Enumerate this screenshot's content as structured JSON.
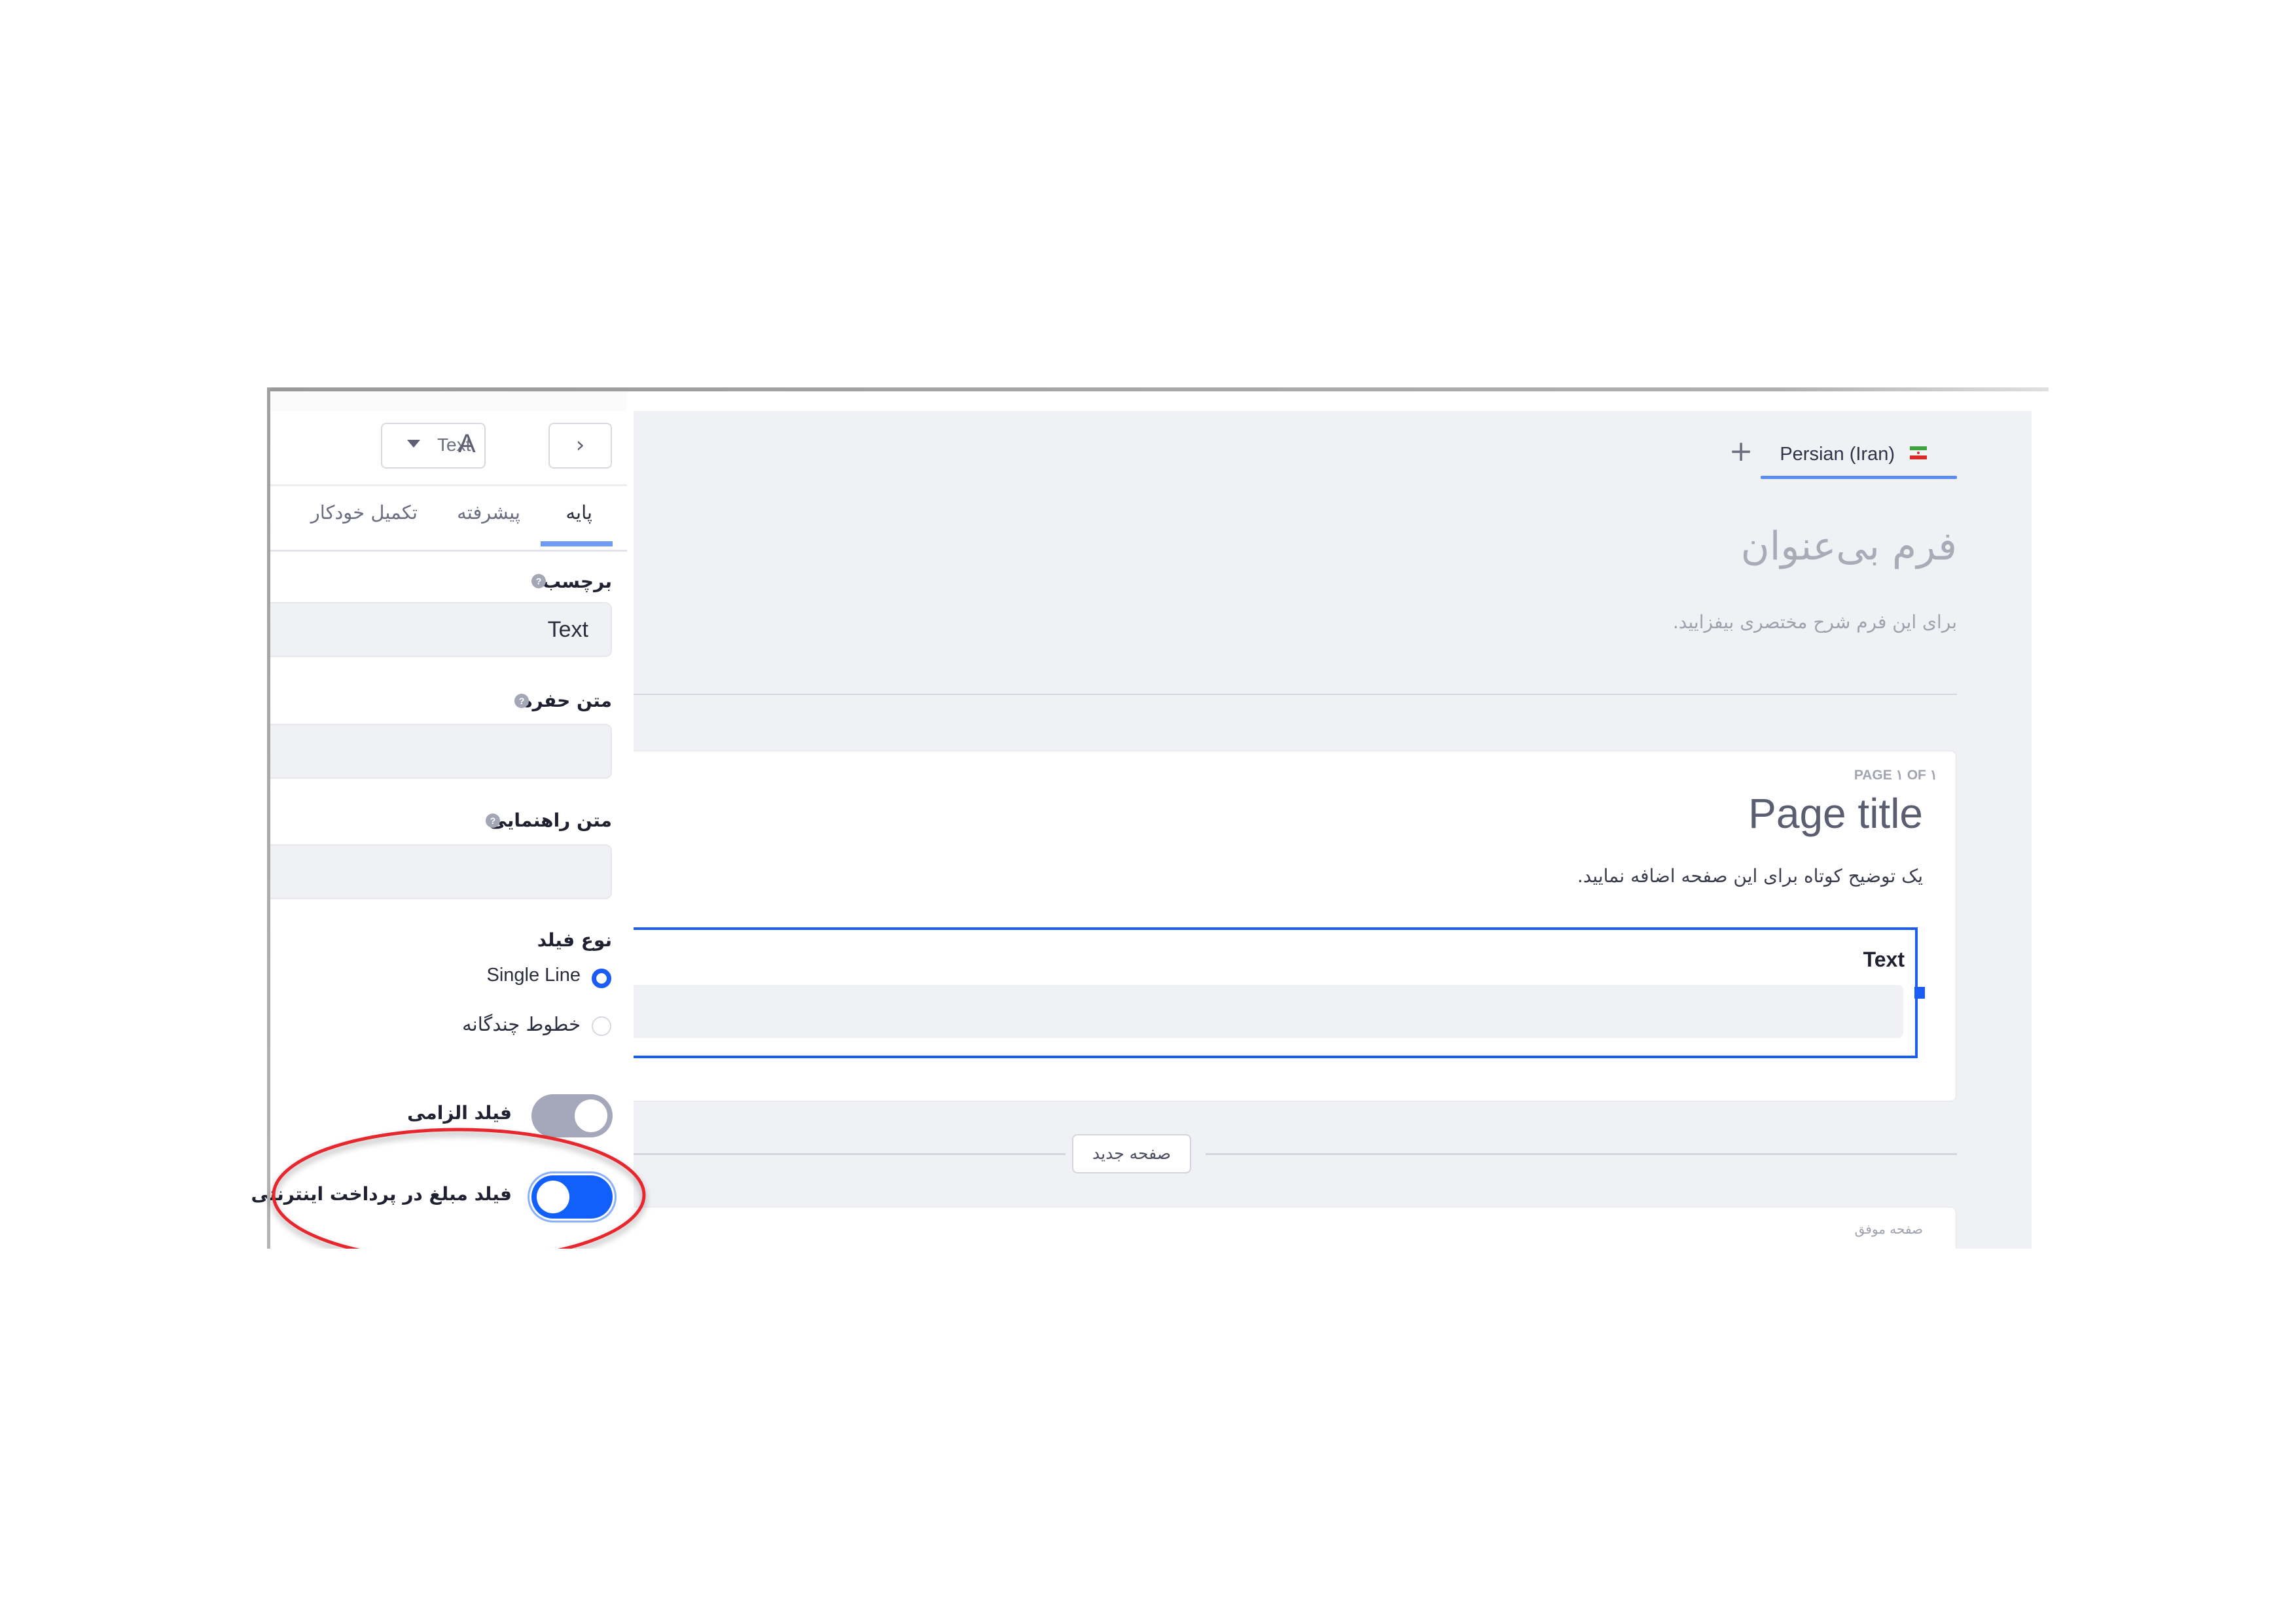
{
  "panel": {
    "type_select": {
      "label": "Text",
      "icon": "text-type-icon",
      "icon_glyph": "A",
      "caret": "caret-down-icon"
    },
    "collapse_button": {
      "icon": "chevron-right-icon",
      "glyph": "›"
    },
    "tabs": [
      {
        "label": "پایه",
        "active": true
      },
      {
        "label": "پیشرفته",
        "active": false
      },
      {
        "label": "تکمیل خودکار",
        "active": false
      }
    ],
    "fields": {
      "label": {
        "title": "برچسب",
        "value": "Text",
        "help": "?"
      },
      "placeholder": {
        "title": "متن حفره",
        "value": "",
        "help": "?"
      },
      "help_text": {
        "title": "متن راهنمایی",
        "value": "",
        "help": "?"
      }
    },
    "field_type": {
      "title": "نوع فیلد",
      "options": [
        {
          "label": "Single Line",
          "selected": true
        },
        {
          "label": "خطوط چندگانه",
          "selected": false
        }
      ]
    },
    "toggles": {
      "required": {
        "label": "فیلد الزامی",
        "on": false
      },
      "payment_amount": {
        "label": "فیلد مبلغ در پرداخت اینترنتی",
        "on": true
      }
    }
  },
  "canvas": {
    "language_tab": {
      "label": "Persian (Iran)",
      "flag": "iran-flag-icon",
      "add": "+"
    },
    "form_title": "فرم بی‌عنوان",
    "form_description": "برای این فرم شرح مختصری بیفزایید.",
    "page": {
      "counter": "PAGE ۱ OF ۱",
      "title": "Page title",
      "description": "یک توضیح کوتاه برای این صفحه اضافه نمایید.",
      "field_label": "Text"
    },
    "new_page_button": "صفحه جدید",
    "success_page_label": "صفحه موفق"
  },
  "colors": {
    "accent": "#1a5cf5",
    "canvas_bg": "#f0f1f5",
    "annotation": "#e8282e"
  }
}
